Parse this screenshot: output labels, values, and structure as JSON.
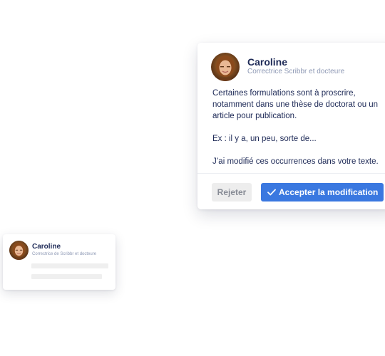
{
  "mini_card": {
    "avatar_icon": "person-avatar-icon",
    "name": "Caroline",
    "role": "Correctrice de Scribbr et docteure"
  },
  "comment": {
    "avatar_icon": "person-avatar-icon",
    "author": "Caroline",
    "role": "Correctrice Scribbr et docteure",
    "paragraphs": [
      "Certaines formulations sont à proscrire, notamment dans une thèse de doctorat ou un article pour publication.",
      "Ex : il y a, un peu, sorte de...",
      "J’ai modifié ces occurrences dans votre texte."
    ],
    "actions": {
      "reject_label": "Rejeter",
      "accept_label": "Accepter la modification",
      "accept_icon": "check-icon"
    }
  },
  "colors": {
    "name_text": "#1e2a57",
    "role_text": "#8d98b4",
    "accent": "#3a78e0",
    "reject_bg": "#ededed",
    "reject_text": "#878b95"
  }
}
